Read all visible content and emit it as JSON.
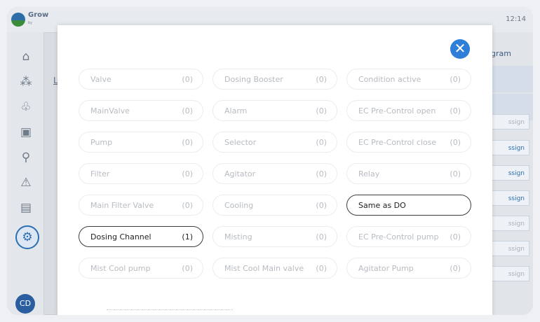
{
  "app": {
    "logo_text": "Grow",
    "logo_sub": "by",
    "topbar_time": "12:14",
    "bg_link": "L",
    "program_label": "gram",
    "assign_label": "ssign",
    "avatar_initials": "CD"
  },
  "modal": {
    "close_symbol": "✕",
    "items": [
      {
        "label": "Valve",
        "count": "(0)",
        "selected": false
      },
      {
        "label": "Dosing Booster",
        "count": "(0)",
        "selected": false
      },
      {
        "label": "Condition active",
        "count": "(0)",
        "selected": false
      },
      {
        "label": "MainValve",
        "count": "(0)",
        "selected": false
      },
      {
        "label": "Alarm",
        "count": "(0)",
        "selected": false
      },
      {
        "label": "EC Pre-Control open",
        "count": "(0)",
        "selected": false
      },
      {
        "label": "Pump",
        "count": "(0)",
        "selected": false
      },
      {
        "label": "Selector",
        "count": "(0)",
        "selected": false
      },
      {
        "label": "EC Pre-Control close",
        "count": "(0)",
        "selected": false
      },
      {
        "label": "Filter",
        "count": "(0)",
        "selected": false
      },
      {
        "label": "Agitator",
        "count": "(0)",
        "selected": false
      },
      {
        "label": "Relay",
        "count": "(0)",
        "selected": false
      },
      {
        "label": "Main Filter Valve",
        "count": "(0)",
        "selected": false
      },
      {
        "label": "Cooling",
        "count": "(0)",
        "selected": false
      },
      {
        "label": "Same as DO",
        "count": "",
        "selected": true
      },
      {
        "label": "Dosing Channel",
        "count": "(1)",
        "selected": true
      },
      {
        "label": "Misting",
        "count": "(0)",
        "selected": false
      },
      {
        "label": "EC Pre-Control pump",
        "count": "(0)",
        "selected": false
      },
      {
        "label": "Mist Cool pump",
        "count": "(0)",
        "selected": false
      },
      {
        "label": "Mist Cool Main valve",
        "count": "(0)",
        "selected": false
      },
      {
        "label": "Agitator Pump",
        "count": "(0)",
        "selected": false
      }
    ]
  },
  "colors": {
    "accent": "#2f7ed8",
    "selected_border": "#3d3d3d",
    "muted_text": "#b7bcc2"
  }
}
